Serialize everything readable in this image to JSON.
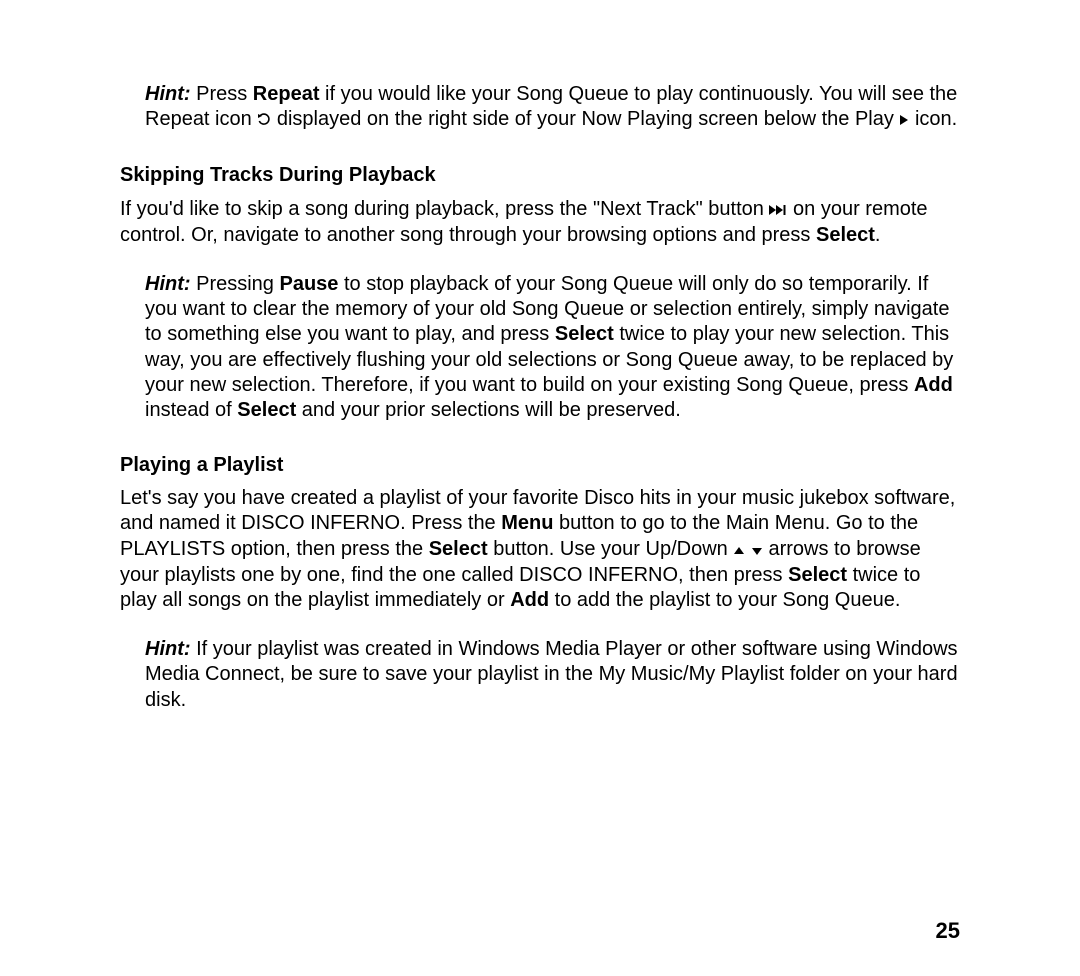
{
  "hints": {
    "repeat": {
      "label": "Hint:",
      "pre": " Press ",
      "repeat": "Repeat",
      "mid1": " if you would like your Song Queue to play continuously. You will see the Repeat icon ",
      "mid2": " displayed on the right side of your Now Playing screen below the Play ",
      "end": " icon."
    },
    "pause": {
      "label": "Hint:",
      "pre": " Pressing ",
      "pause": "Pause",
      "mid1": " to stop playback of your Song Queue will only do so temporarily. If you want to clear the memory of your old Song Queue or selection entirely, simply navigate to something else you want to play, and press ",
      "select1": "Select",
      "mid2": " twice to play your new selection. This way, you are effectively flushing your old selections or Song Queue away, to be replaced by your new selection. Therefore, if you want to build on your existing Song Queue, press ",
      "add": "Add",
      "mid3": " instead of ",
      "select2": "Select",
      "end": " and your prior selections will be preserved."
    },
    "playlist": {
      "label": "Hint:",
      "body": " If your playlist was created in Windows Media Player or other software using Windows Media Connect, be sure to save your playlist in the My Music/My Playlist folder on your hard disk."
    }
  },
  "sections": {
    "skipping": {
      "title": "Skipping Tracks During Playback",
      "p1a": "If you'd like to skip a song during playback, press the \"Next Track\" button ",
      "p1b": " on your remote control.  Or, navigate to another song through your browsing options and press ",
      "select": "Select",
      "p1c": "."
    },
    "playing": {
      "title": "Playing a Playlist",
      "p1a": "Let's say you have created a playlist of your favorite Disco hits in your music jukebox software, and named it DISCO INFERNO. Press the ",
      "menu": "Menu",
      "p1b": " button to go to the Main Menu. Go to the PLAYLISTS option, then press the ",
      "select1": "Select",
      "p1c": " button. Use your Up/Down ",
      "p1d": " arrows to browse your playlists one by one, find the one called DISCO INFERNO, then press ",
      "select2": "Select",
      "p1e": " twice to play all songs on the playlist immediately or ",
      "add": "Add",
      "p1f": " to add the playlist to your Song Queue."
    }
  },
  "page_number": "25"
}
